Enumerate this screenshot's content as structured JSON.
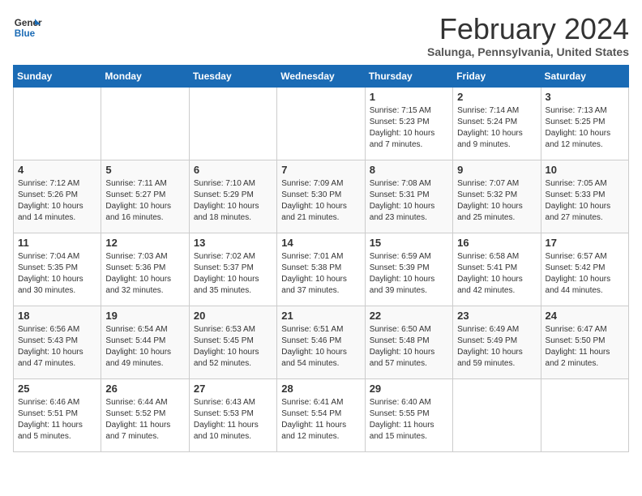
{
  "logo": {
    "line1": "General",
    "line2": "Blue"
  },
  "title": "February 2024",
  "subtitle": "Salunga, Pennsylvania, United States",
  "days_of_week": [
    "Sunday",
    "Monday",
    "Tuesday",
    "Wednesday",
    "Thursday",
    "Friday",
    "Saturday"
  ],
  "weeks": [
    [
      {
        "day": "",
        "info": ""
      },
      {
        "day": "",
        "info": ""
      },
      {
        "day": "",
        "info": ""
      },
      {
        "day": "",
        "info": ""
      },
      {
        "day": "1",
        "info": "Sunrise: 7:15 AM\nSunset: 5:23 PM\nDaylight: 10 hours\nand 7 minutes."
      },
      {
        "day": "2",
        "info": "Sunrise: 7:14 AM\nSunset: 5:24 PM\nDaylight: 10 hours\nand 9 minutes."
      },
      {
        "day": "3",
        "info": "Sunrise: 7:13 AM\nSunset: 5:25 PM\nDaylight: 10 hours\nand 12 minutes."
      }
    ],
    [
      {
        "day": "4",
        "info": "Sunrise: 7:12 AM\nSunset: 5:26 PM\nDaylight: 10 hours\nand 14 minutes."
      },
      {
        "day": "5",
        "info": "Sunrise: 7:11 AM\nSunset: 5:27 PM\nDaylight: 10 hours\nand 16 minutes."
      },
      {
        "day": "6",
        "info": "Sunrise: 7:10 AM\nSunset: 5:29 PM\nDaylight: 10 hours\nand 18 minutes."
      },
      {
        "day": "7",
        "info": "Sunrise: 7:09 AM\nSunset: 5:30 PM\nDaylight: 10 hours\nand 21 minutes."
      },
      {
        "day": "8",
        "info": "Sunrise: 7:08 AM\nSunset: 5:31 PM\nDaylight: 10 hours\nand 23 minutes."
      },
      {
        "day": "9",
        "info": "Sunrise: 7:07 AM\nSunset: 5:32 PM\nDaylight: 10 hours\nand 25 minutes."
      },
      {
        "day": "10",
        "info": "Sunrise: 7:05 AM\nSunset: 5:33 PM\nDaylight: 10 hours\nand 27 minutes."
      }
    ],
    [
      {
        "day": "11",
        "info": "Sunrise: 7:04 AM\nSunset: 5:35 PM\nDaylight: 10 hours\nand 30 minutes."
      },
      {
        "day": "12",
        "info": "Sunrise: 7:03 AM\nSunset: 5:36 PM\nDaylight: 10 hours\nand 32 minutes."
      },
      {
        "day": "13",
        "info": "Sunrise: 7:02 AM\nSunset: 5:37 PM\nDaylight: 10 hours\nand 35 minutes."
      },
      {
        "day": "14",
        "info": "Sunrise: 7:01 AM\nSunset: 5:38 PM\nDaylight: 10 hours\nand 37 minutes."
      },
      {
        "day": "15",
        "info": "Sunrise: 6:59 AM\nSunset: 5:39 PM\nDaylight: 10 hours\nand 39 minutes."
      },
      {
        "day": "16",
        "info": "Sunrise: 6:58 AM\nSunset: 5:41 PM\nDaylight: 10 hours\nand 42 minutes."
      },
      {
        "day": "17",
        "info": "Sunrise: 6:57 AM\nSunset: 5:42 PM\nDaylight: 10 hours\nand 44 minutes."
      }
    ],
    [
      {
        "day": "18",
        "info": "Sunrise: 6:56 AM\nSunset: 5:43 PM\nDaylight: 10 hours\nand 47 minutes."
      },
      {
        "day": "19",
        "info": "Sunrise: 6:54 AM\nSunset: 5:44 PM\nDaylight: 10 hours\nand 49 minutes."
      },
      {
        "day": "20",
        "info": "Sunrise: 6:53 AM\nSunset: 5:45 PM\nDaylight: 10 hours\nand 52 minutes."
      },
      {
        "day": "21",
        "info": "Sunrise: 6:51 AM\nSunset: 5:46 PM\nDaylight: 10 hours\nand 54 minutes."
      },
      {
        "day": "22",
        "info": "Sunrise: 6:50 AM\nSunset: 5:48 PM\nDaylight: 10 hours\nand 57 minutes."
      },
      {
        "day": "23",
        "info": "Sunrise: 6:49 AM\nSunset: 5:49 PM\nDaylight: 10 hours\nand 59 minutes."
      },
      {
        "day": "24",
        "info": "Sunrise: 6:47 AM\nSunset: 5:50 PM\nDaylight: 11 hours\nand 2 minutes."
      }
    ],
    [
      {
        "day": "25",
        "info": "Sunrise: 6:46 AM\nSunset: 5:51 PM\nDaylight: 11 hours\nand 5 minutes."
      },
      {
        "day": "26",
        "info": "Sunrise: 6:44 AM\nSunset: 5:52 PM\nDaylight: 11 hours\nand 7 minutes."
      },
      {
        "day": "27",
        "info": "Sunrise: 6:43 AM\nSunset: 5:53 PM\nDaylight: 11 hours\nand 10 minutes."
      },
      {
        "day": "28",
        "info": "Sunrise: 6:41 AM\nSunset: 5:54 PM\nDaylight: 11 hours\nand 12 minutes."
      },
      {
        "day": "29",
        "info": "Sunrise: 6:40 AM\nSunset: 5:55 PM\nDaylight: 11 hours\nand 15 minutes."
      },
      {
        "day": "",
        "info": ""
      },
      {
        "day": "",
        "info": ""
      }
    ]
  ]
}
